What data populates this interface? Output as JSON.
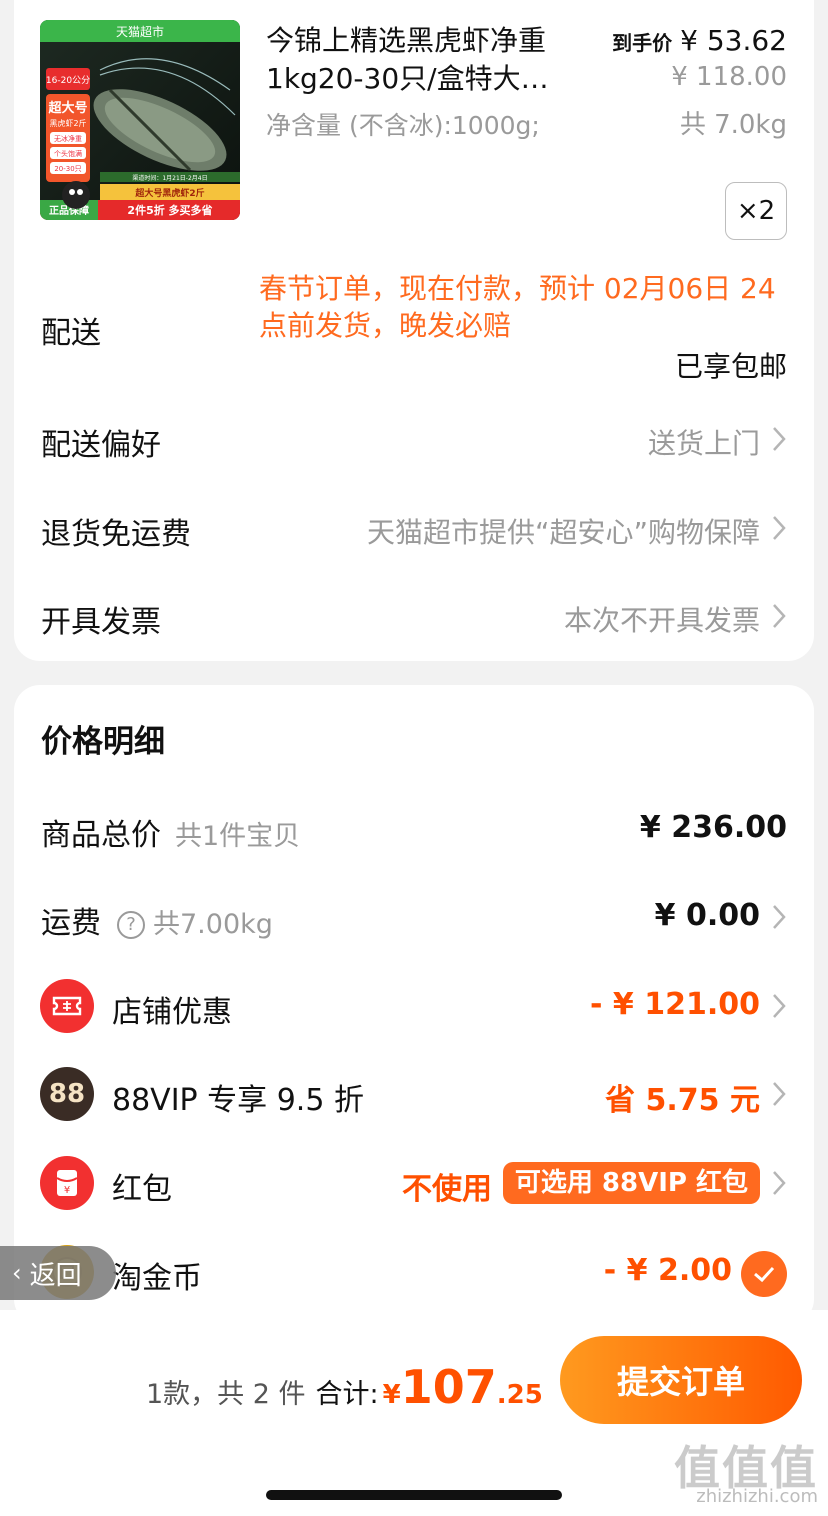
{
  "product": {
    "title": "今锦上精选黑虎虾净重1kg20-30只/盒特大…",
    "spec": "净含量 (不含冰):1000g;",
    "price_tag": "到手价",
    "price": "¥ 53.62",
    "original_price": "¥ 118.00",
    "weight": "共 7.0kg",
    "quantity": "×2",
    "thumb": {
      "store": "天猫超市",
      "size_range": "16-20公分",
      "badge_big": "超大号",
      "badge_sub": "黑虎虾2斤",
      "tags": [
        "无冰净重",
        "个头饱满",
        "20-30只"
      ],
      "delivery": "渠道时间：1月21日-2月4日",
      "banner1": "超大号黑虎虾2斤",
      "guarantee": "正品保障",
      "promo": "2件5折 多买多省"
    }
  },
  "delivery": {
    "label": "配送",
    "note": "春节订单，现在付款，预计 02月06日 24点前发货，晚发必赔",
    "free_shipping": "已享包邮"
  },
  "preference": {
    "label": "配送偏好",
    "value": "送货上门"
  },
  "returns": {
    "label": "退货免运费",
    "value": "天猫超市提供“超安心”购物保障"
  },
  "invoice": {
    "label": "开具发票",
    "value": "本次不开具发票"
  },
  "price_detail": {
    "title": "价格明细",
    "goods_total_label": "商品总价",
    "goods_total_sub": "共1件宝贝",
    "goods_total": "¥ 236.00",
    "freight_label": "运费",
    "freight_sub": "共7.00kg",
    "freight": "¥ 0.00",
    "store_discount_label": "店铺优惠",
    "store_discount": "- ¥ 121.00",
    "vip_label": "88VIP 专享 9.5 折",
    "vip_icon_text": "88",
    "vip_saving": "省 5.75 元",
    "redpacket_label": "红包",
    "redpacket_status": "不使用",
    "redpacket_pill": "可选用 88VIP 红包",
    "coin_label": "淘金币",
    "coin_value": "- ¥ 2.00"
  },
  "back_button": "返回",
  "bottom": {
    "count": "1款，共 2 件",
    "total_label": "合计:",
    "total_yen": "¥",
    "total_int": "107",
    "total_dec": ".25",
    "submit": "提交订单"
  },
  "watermark": {
    "brand": "值值值",
    "url": "zhizhizhi.com"
  },
  "colors": {
    "accent": "#ff5000",
    "note_orange": "#ff6a1f",
    "submit_gradient": [
      "#ff9a1f",
      "#ff5a00"
    ]
  }
}
